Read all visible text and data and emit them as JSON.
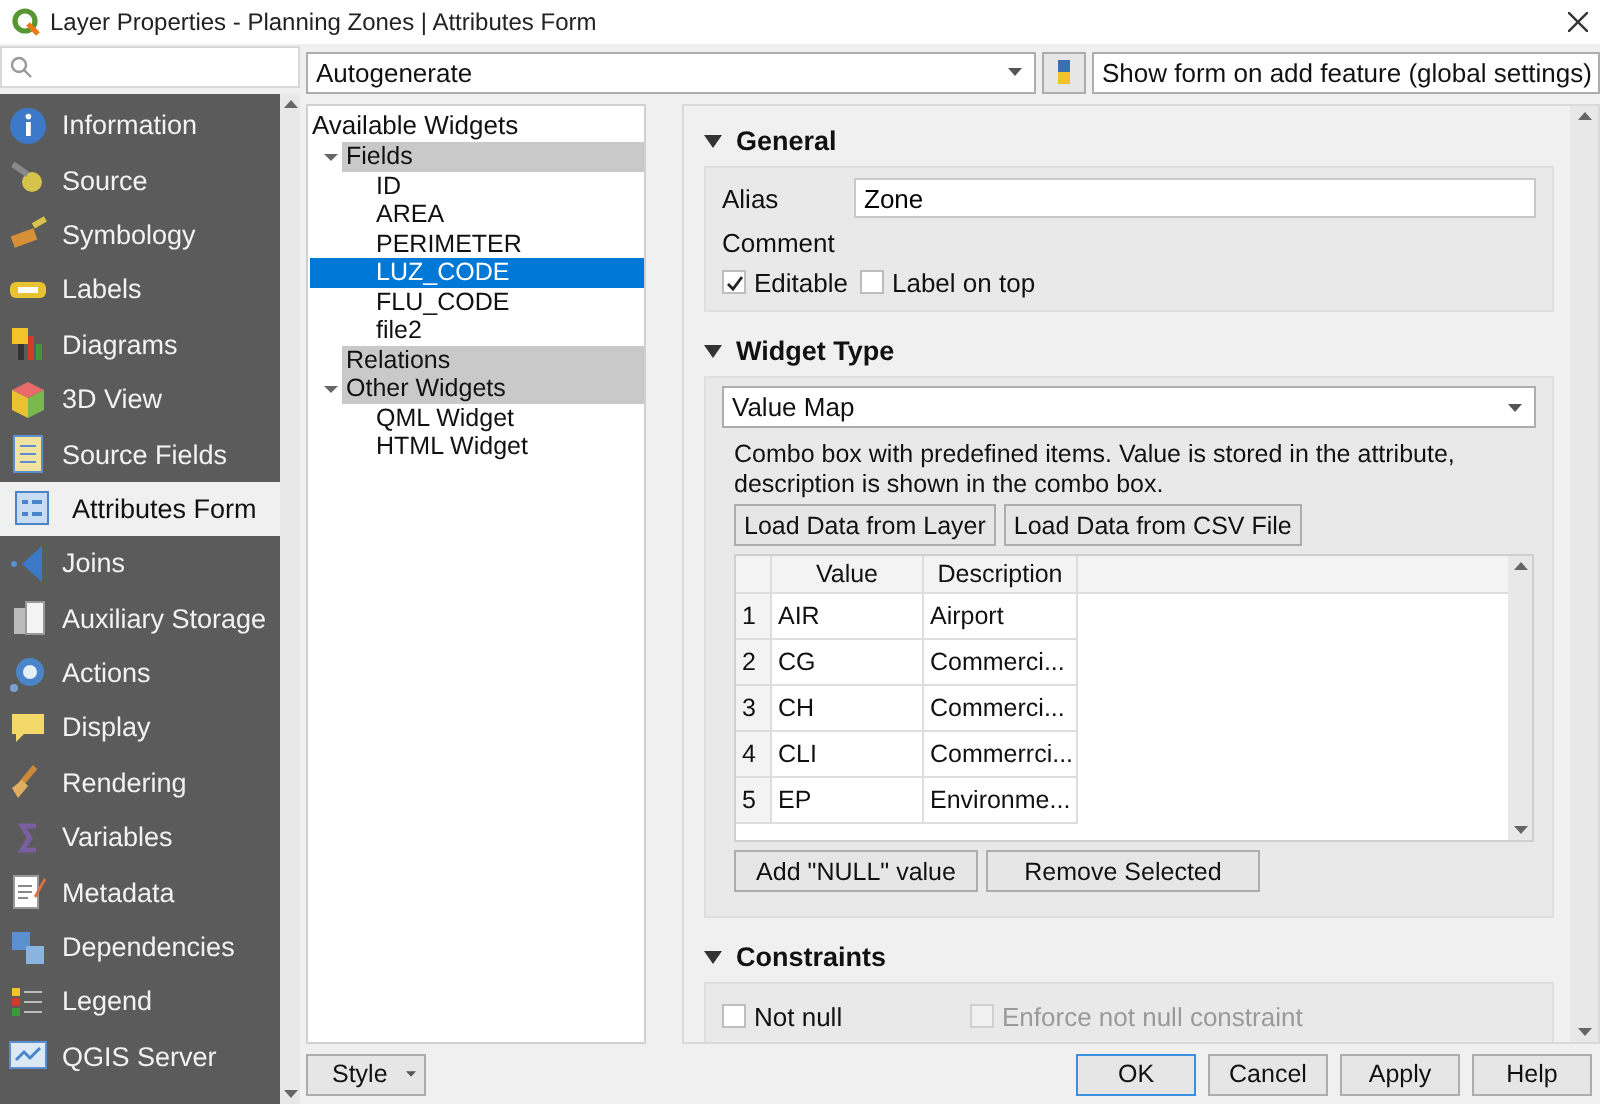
{
  "window": {
    "title": "Layer Properties - Planning Zones | Attributes Form"
  },
  "sidebar": {
    "items": [
      {
        "label": "Information",
        "selected": false
      },
      {
        "label": "Source",
        "selected": false
      },
      {
        "label": "Symbology",
        "selected": false
      },
      {
        "label": "Labels",
        "selected": false
      },
      {
        "label": "Diagrams",
        "selected": false
      },
      {
        "label": "3D View",
        "selected": false
      },
      {
        "label": "Source Fields",
        "selected": false
      },
      {
        "label": "Attributes Form",
        "selected": true
      },
      {
        "label": "Joins",
        "selected": false
      },
      {
        "label": "Auxiliary Storage",
        "selected": false
      },
      {
        "label": "Actions",
        "selected": false
      },
      {
        "label": "Display",
        "selected": false
      },
      {
        "label": "Rendering",
        "selected": false
      },
      {
        "label": "Variables",
        "selected": false
      },
      {
        "label": "Metadata",
        "selected": false
      },
      {
        "label": "Dependencies",
        "selected": false
      },
      {
        "label": "Legend",
        "selected": false
      },
      {
        "label": "QGIS Server",
        "selected": false
      }
    ]
  },
  "toolbar": {
    "layout_combo": "Autogenerate",
    "show_form_combo": "Show form on add feature (global settings)"
  },
  "widget_tree": {
    "header": "Available Widgets",
    "items": [
      {
        "label": "Fields",
        "expanded": true,
        "children": [
          {
            "label": "ID",
            "selected": false
          },
          {
            "label": "AREA",
            "selected": false
          },
          {
            "label": "PERIMETER",
            "selected": false
          },
          {
            "label": "LUZ_CODE",
            "selected": true
          },
          {
            "label": "FLU_CODE",
            "selected": false
          },
          {
            "label": "file2",
            "selected": false
          }
        ]
      },
      {
        "label": "Relations"
      },
      {
        "label": "Other Widgets",
        "expanded": true,
        "children": [
          {
            "label": "QML Widget",
            "selected": false
          },
          {
            "label": "HTML Widget",
            "selected": false
          }
        ]
      }
    ]
  },
  "general": {
    "title": "General",
    "expanded": true,
    "alias_label": "Alias",
    "alias_value": "Zone",
    "comment_label": "Comment",
    "checkboxes": [
      {
        "label": "Editable",
        "checked": true
      },
      {
        "label": "Label on top",
        "checked": false
      }
    ]
  },
  "widget_type": {
    "title": "Widget Type",
    "expanded": true,
    "combo": "Value Map",
    "description": "Combo box with predefined items. Value is stored in the attribute, description is shown in the combo box.",
    "load_buttons": [
      "Load Data from Layer",
      "Load Data from CSV File"
    ],
    "table": {
      "columns": [
        "Value",
        "Description"
      ],
      "rows": [
        {
          "number": "1",
          "value": "AIR",
          "description": "Airport"
        },
        {
          "number": "2",
          "value": "CG",
          "description": "Commerci..."
        },
        {
          "number": "3",
          "value": "CH",
          "description": "Commerci..."
        },
        {
          "number": "4",
          "value": "CLI",
          "description": "Commerrci..."
        },
        {
          "number": "5",
          "value": "EP",
          "description": "Environme..."
        }
      ]
    },
    "buttons": [
      "Add \"NULL\" value",
      "Remove Selected"
    ]
  },
  "constraints": {
    "title": "Constraints",
    "expanded": true,
    "rows": [
      {
        "label": "Not null",
        "checked": false,
        "enforce_label": "Enforce not null constraint",
        "enforce_checked": false,
        "enforce_disabled": true
      }
    ]
  },
  "footer": {
    "style_button": "Style",
    "buttons": [
      {
        "label": "OK",
        "default": true
      },
      {
        "label": "Cancel",
        "default": false
      },
      {
        "label": "Apply",
        "default": false
      },
      {
        "label": "Help",
        "default": false
      }
    ]
  }
}
